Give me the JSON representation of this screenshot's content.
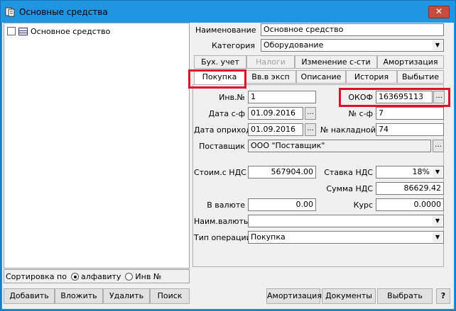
{
  "window": {
    "title": "Основные средства",
    "close_label": "✕"
  },
  "tree": {
    "items": [
      {
        "label": "Основное средство"
      }
    ]
  },
  "sort": {
    "label": "Сортировка по",
    "option_alpha": "алфавиту",
    "option_inv": "Инв №",
    "selected": "алфавиту"
  },
  "left_buttons": {
    "add": "Добавить",
    "insert": "Вложить",
    "delete": "Удалить",
    "search": "Поиск"
  },
  "header": {
    "name_label": "Наименование",
    "name_value": "Основное средство",
    "category_label": "Категория",
    "category_value": "Оборудование"
  },
  "tabs_row1": [
    "Бух. учет",
    "Налоги",
    "Изменение с-сти",
    "Амортизация"
  ],
  "tabs_row2": [
    "Покупка",
    "Вв.в эксп",
    "Описание",
    "История",
    "Выбытие"
  ],
  "purchase": {
    "inv_label": "Инв.№",
    "inv_value": "1",
    "okof_label": "ОКОФ",
    "okof_value": "163695113",
    "date_sf_label": "Дата с-ф",
    "date_sf_value": "01.09.2016",
    "num_sf_label": "№ с-ф",
    "num_sf_value": "7",
    "date_pay_label": "Дата оприход",
    "date_pay_value": "01.09.2016",
    "num_nakl_label": "№ накладной",
    "num_nakl_value": "74",
    "supplier_label": "Поставщик",
    "supplier_value": "ООО \"Поставщик\"",
    "cost_label": "Стоим.с НДС",
    "cost_value": "567904.00",
    "vat_rate_label": "Ставка НДС",
    "vat_rate_value": "18%",
    "vat_sum_label": "Сумма НДС",
    "vat_sum_value": "86629.42",
    "currency_amt_label": "В валюте",
    "currency_amt_value": "0.00",
    "rate_label": "Курс",
    "rate_value": "0.0000",
    "currency_name_label": "Наим.валюты",
    "currency_name_value": "",
    "op_type_label": "Тип операции",
    "op_type_value": "Покупка",
    "ellipsis": "..."
  },
  "right_buttons": {
    "amort": "Амортизация",
    "docs": "Документы",
    "select": "Выбрать",
    "help": "?"
  },
  "colors": {
    "title_bar": "#2196e0",
    "highlight": "#e0102a"
  }
}
